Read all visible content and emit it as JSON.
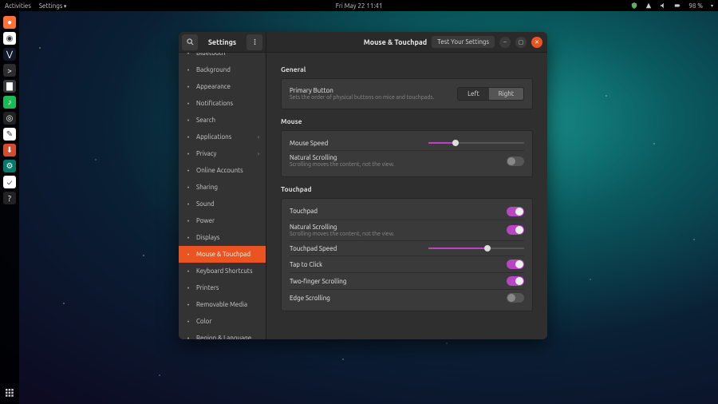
{
  "topbar": {
    "activities": "Activities",
    "settings": "Settings",
    "clock": "Fri May 22  11:41",
    "battery": "98 %"
  },
  "dock": {
    "items": [
      {
        "name": "firefox",
        "bg": "#ff7139",
        "glyph": "●"
      },
      {
        "name": "chrome",
        "bg": "#ffffff",
        "glyph": "◉"
      },
      {
        "name": "vscode",
        "bg": "#13172a",
        "glyph": "⋁"
      },
      {
        "name": "terminal",
        "bg": "#2d2d2d",
        "glyph": ">"
      },
      {
        "name": "files",
        "bg": "#3a3a3a",
        "glyph": "▇"
      },
      {
        "name": "spotify",
        "bg": "#1db954",
        "glyph": "♪"
      },
      {
        "name": "obs",
        "bg": "#222",
        "glyph": "◎"
      },
      {
        "name": "text-editor",
        "bg": "#ffffff",
        "glyph": "✎"
      },
      {
        "name": "software",
        "bg": "#d84a2e",
        "glyph": "⬇"
      },
      {
        "name": "settings",
        "bg": "#057a6b",
        "glyph": "⚙"
      },
      {
        "name": "todo",
        "bg": "#ffffff",
        "glyph": "✓"
      },
      {
        "name": "help",
        "bg": "#222",
        "glyph": "?"
      }
    ],
    "apps_button_name": "show-applications"
  },
  "window": {
    "title": "Settings",
    "pane_title": "Mouse & Touchpad",
    "test_button": "Test Your Settings"
  },
  "sidebar": {
    "items": [
      {
        "label": "Bluetooth",
        "chevron": false
      },
      {
        "label": "Background",
        "chevron": false
      },
      {
        "label": "Appearance",
        "chevron": false
      },
      {
        "label": "Notifications",
        "chevron": false
      },
      {
        "label": "Search",
        "chevron": false
      },
      {
        "label": "Applications",
        "chevron": true
      },
      {
        "label": "Privacy",
        "chevron": true
      },
      {
        "label": "Online Accounts",
        "chevron": false
      },
      {
        "label": "Sharing",
        "chevron": false
      },
      {
        "label": "Sound",
        "chevron": false
      },
      {
        "label": "Power",
        "chevron": false
      },
      {
        "label": "Displays",
        "chevron": false
      },
      {
        "label": "Mouse & Touchpad",
        "chevron": false,
        "active": true
      },
      {
        "label": "Keyboard Shortcuts",
        "chevron": false
      },
      {
        "label": "Printers",
        "chevron": false
      },
      {
        "label": "Removable Media",
        "chevron": false
      },
      {
        "label": "Color",
        "chevron": false
      },
      {
        "label": "Region & Language",
        "chevron": false
      }
    ]
  },
  "sections": {
    "general": {
      "title": "General",
      "primary_button": {
        "label": "Primary Button",
        "desc": "Sets the order of physical buttons on mice and touchpads.",
        "left": "Left",
        "right": "Right",
        "selected": "right"
      }
    },
    "mouse": {
      "title": "Mouse",
      "speed_label": "Mouse Speed",
      "speed_value": 28,
      "natural_scroll_label": "Natural Scrolling",
      "natural_scroll_desc": "Scrolling moves the content, not the view.",
      "natural_scroll_on": false
    },
    "touchpad": {
      "title": "Touchpad",
      "touchpad_label": "Touchpad",
      "touchpad_on": true,
      "natural_scroll_label": "Natural Scrolling",
      "natural_scroll_desc": "Scrolling moves the content, not the view.",
      "natural_scroll_on": true,
      "speed_label": "Touchpad Speed",
      "speed_value": 62,
      "tap_label": "Tap to Click",
      "tap_on": true,
      "twofinger_label": "Two-finger Scrolling",
      "twofinger_on": true,
      "edge_label": "Edge Scrolling",
      "edge_on": false
    }
  }
}
